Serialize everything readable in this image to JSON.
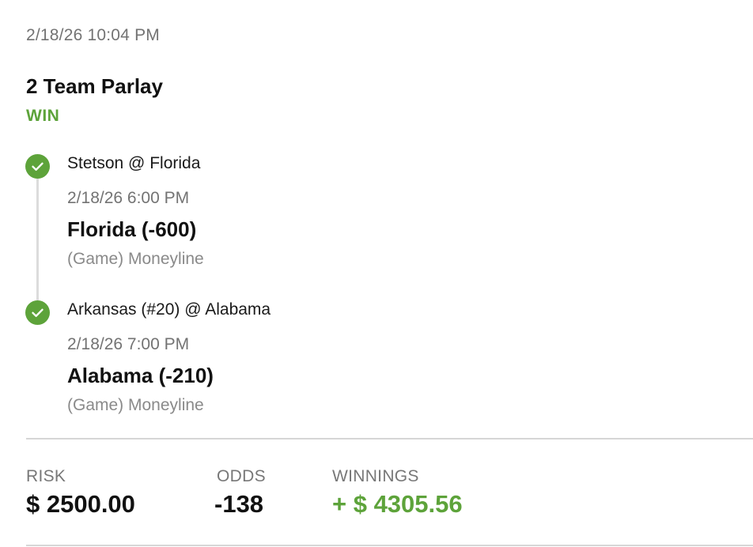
{
  "ticket": {
    "placed_at": "2/18/26 10:04 PM",
    "bet_type": "2 Team Parlay",
    "status": "WIN",
    "status_color": "#5da33a"
  },
  "legs": [
    {
      "status_icon": "check-circle-icon",
      "matchup": "Stetson @ Florida",
      "game_time": "2/18/26 6:00 PM",
      "pick": "Florida (-600)",
      "market": "(Game) Moneyline"
    },
    {
      "status_icon": "check-circle-icon",
      "matchup": "Arkansas (#20) @ Alabama",
      "game_time": "2/18/26 7:00 PM",
      "pick": "Alabama (-210)",
      "market": "(Game) Moneyline"
    }
  ],
  "summary": {
    "risk_label": "RISK",
    "risk_value": "$ 2500.00",
    "odds_label": "ODDS",
    "odds_value": "-138",
    "winnings_label": "WINNINGS",
    "winnings_value": "+ $ 4305.56"
  }
}
